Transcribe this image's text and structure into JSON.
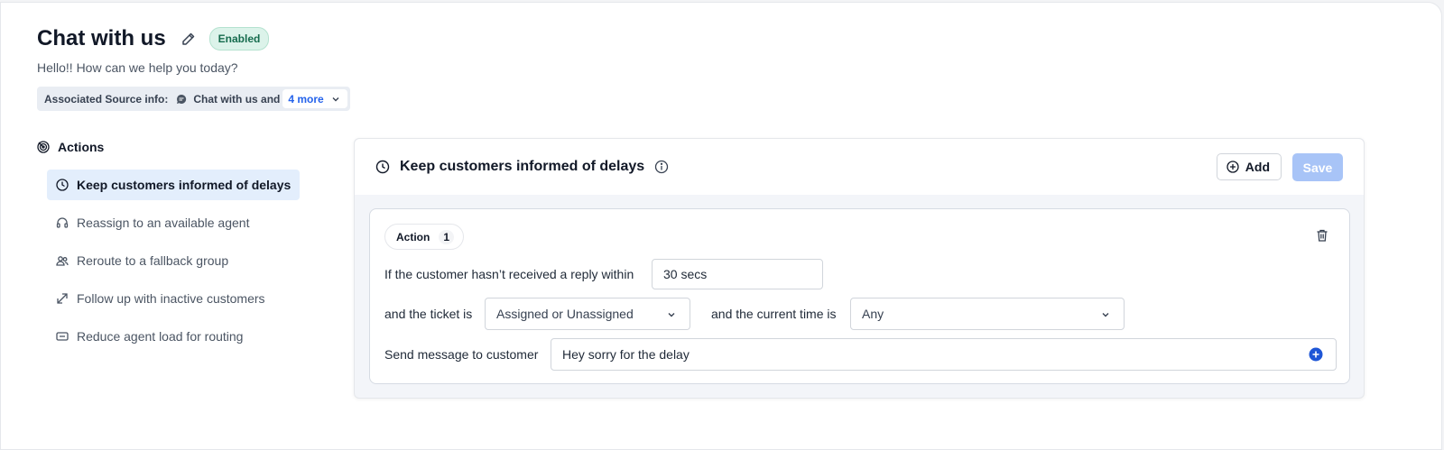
{
  "header": {
    "title": "Chat with us",
    "status": "Enabled",
    "subtitle": "Hello!! How can we help you today?",
    "source_label": "Associated Source info:",
    "source_name": "Chat with us and",
    "source_more": "4 more"
  },
  "sidebar": {
    "heading": "Actions",
    "items": [
      {
        "label": "Keep customers informed of delays",
        "icon": "clock-icon",
        "active": true
      },
      {
        "label": "Reassign to an available agent",
        "icon": "headset-icon"
      },
      {
        "label": "Reroute to a fallback group",
        "icon": "group-icon"
      },
      {
        "label": "Follow up with inactive customers",
        "icon": "arrows-icon"
      },
      {
        "label": "Reduce agent load for routing",
        "icon": "ticket-icon"
      }
    ]
  },
  "panel": {
    "title": "Keep customers informed of delays",
    "add_label": "Add",
    "save_label": "Save",
    "action": {
      "label": "Action",
      "number": "1",
      "reply_label": "If the customer hasn’t received a reply within",
      "reply_value": "30 secs",
      "ticket_label": "and the ticket is",
      "ticket_value": "Assigned or Unassigned",
      "time_label": "and the current time is",
      "time_value": "Any",
      "message_label": "Send message to customer",
      "message_value": "Hey sorry for the delay"
    }
  },
  "colors": {
    "accent": "#2563eb",
    "active_bg": "#e3eefc",
    "status_bg": "#dcf3ea",
    "save_disabled": "#a8c4f7"
  }
}
